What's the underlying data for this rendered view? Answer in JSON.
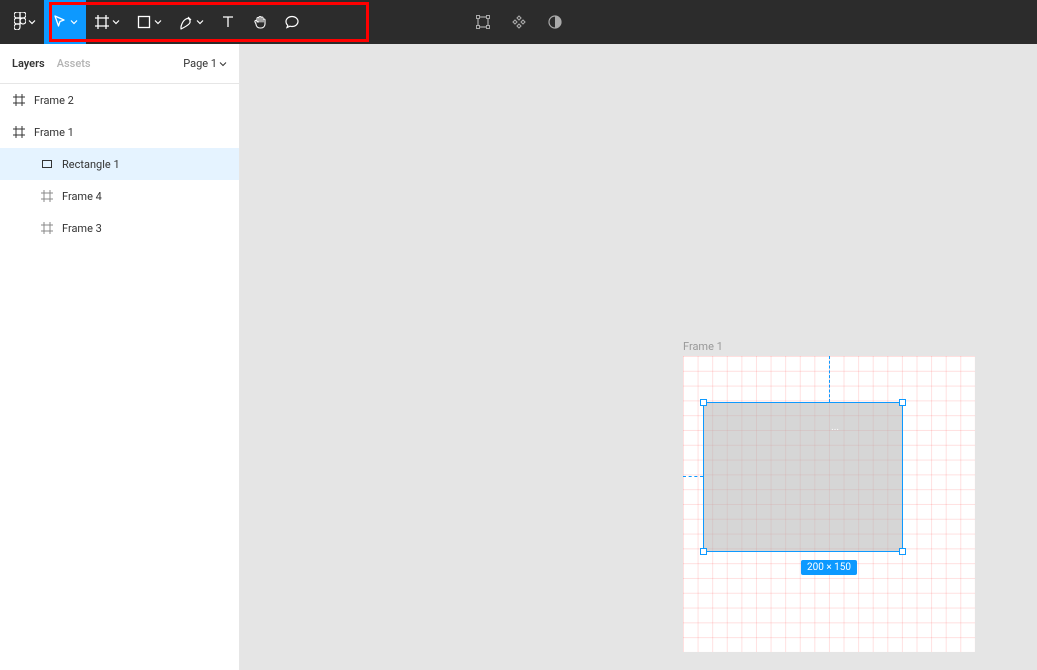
{
  "sidebar": {
    "tabs": {
      "layers": "Layers",
      "assets": "Assets"
    },
    "page_label": "Page 1"
  },
  "layers": [
    {
      "name": "Frame 2",
      "type": "frame",
      "indent": 0,
      "selected": false
    },
    {
      "name": "Frame 1",
      "type": "frame",
      "indent": 0,
      "selected": false
    },
    {
      "name": "Rectangle 1",
      "type": "rect",
      "indent": 1,
      "selected": true
    },
    {
      "name": "Frame 4",
      "type": "frame",
      "indent": 1,
      "selected": false
    },
    {
      "name": "Frame 3",
      "type": "frame",
      "indent": 1,
      "selected": false
    }
  ],
  "canvas": {
    "frame": {
      "label": "Frame 1"
    },
    "selection": {
      "size_label": "200 × 150"
    }
  },
  "right_marks": "..."
}
